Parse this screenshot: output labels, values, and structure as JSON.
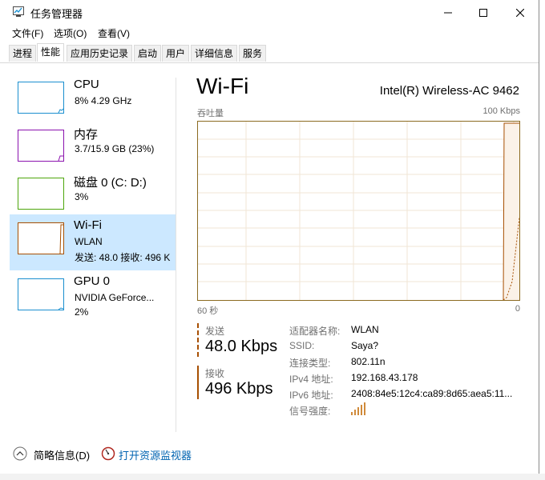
{
  "window": {
    "title": "任务管理器",
    "controls": {
      "minimize": "minimize-icon",
      "maximize": "maximize-icon",
      "close": "close-icon"
    }
  },
  "menu": [
    "文件(F)",
    "选项(O)",
    "查看(V)"
  ],
  "tabs": [
    "进程",
    "性能",
    "应用历史记录",
    "启动",
    "用户",
    "详细信息",
    "服务"
  ],
  "active_tab": "性能",
  "resources": [
    {
      "name": "CPU",
      "sub": "8% 4.29 GHz",
      "sub2": "",
      "color": "#1a8fcf"
    },
    {
      "name": "内存",
      "sub": "3.7/15.9 GB (23%)",
      "sub2": "",
      "color": "#8b12ae"
    },
    {
      "name": "磁盘 0 (C: D:)",
      "sub": "3%",
      "sub2": "",
      "color": "#4da60c"
    },
    {
      "name": "Wi-Fi",
      "sub": "WLAN",
      "sub2": "发送: 48.0 接收: 496 K",
      "color": "#a74f01"
    },
    {
      "name": "GPU 0",
      "sub": "NVIDIA GeForce...",
      "sub2": "2%",
      "color": "#1a8fcf"
    }
  ],
  "detail": {
    "title": "Wi-Fi",
    "adapter": "Intel(R) Wireless-AC 9462",
    "graph_top_left": "吞吐量",
    "graph_top_right": "100 Kbps",
    "graph_bottom_left": "60 秒",
    "graph_bottom_right": "0",
    "send_label": "发送",
    "send_value": "48.0 Kbps",
    "recv_label": "接收",
    "recv_value": "496 Kbps",
    "properties": [
      {
        "key": "适配器名称:",
        "value": "WLAN"
      },
      {
        "key": "SSID:",
        "value": "Saya?"
      },
      {
        "key": "连接类型:",
        "value": "802.11n"
      },
      {
        "key": "IPv4 地址:",
        "value": "192.168.43.178"
      },
      {
        "key": "IPv6 地址:",
        "value": "2408:84e5:12c4:ca89:8d65:aea5:11..."
      },
      {
        "key": "信号强度:",
        "value": ""
      }
    ],
    "signal_bars": 5
  },
  "footer": {
    "fewer_details": "简略信息(D)",
    "open_monitor": "打开资源监视器"
  },
  "colors": {
    "wifi_accent": "#a74f01",
    "selected_bg": "#cce8ff",
    "link": "#0063b1"
  }
}
